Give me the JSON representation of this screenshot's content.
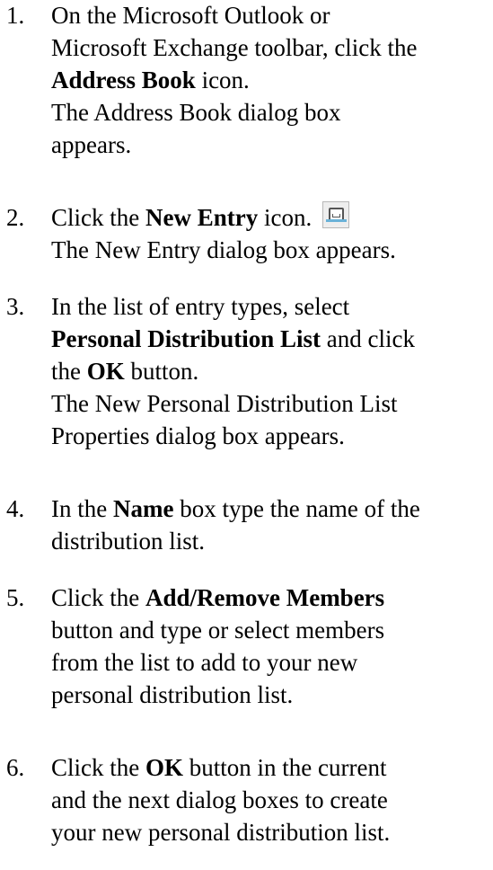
{
  "steps": [
    {
      "number": "1.",
      "lines": [
        [
          {
            "t": "On the Microsoft Outlook or"
          }
        ],
        [
          {
            "t": "Microsoft Exchange toolbar, click the"
          }
        ],
        [
          {
            "t": "Address Book",
            "b": true
          },
          {
            "t": " icon."
          }
        ],
        [
          {
            "t": "The Address Book dialog box"
          }
        ],
        [
          {
            "t": "appears."
          }
        ]
      ]
    },
    {
      "number": "2.",
      "lines": [
        [
          {
            "t": "Click the "
          },
          {
            "t": "New Entry",
            "b": true
          },
          {
            "t": " icon."
          },
          {
            "icon": "new-entry-icon"
          }
        ],
        [
          {
            "t": "The New Entry dialog box appears."
          }
        ]
      ]
    },
    {
      "number": "3.",
      "lines": [
        [
          {
            "t": "In the list of entry types, select"
          }
        ],
        [
          {
            "t": "Personal Distribution List",
            "b": true
          },
          {
            "t": " and click"
          }
        ],
        [
          {
            "t": "the "
          },
          {
            "t": "OK",
            "b": true
          },
          {
            "t": " button."
          }
        ],
        [
          {
            "t": "The New Personal Distribution List"
          }
        ],
        [
          {
            "t": "Properties dialog box appears."
          }
        ]
      ]
    },
    {
      "number": "4.",
      "lines": [
        [
          {
            "t": "In the "
          },
          {
            "t": "Name",
            "b": true
          },
          {
            "t": " box type the name of the"
          }
        ],
        [
          {
            "t": "distribution list."
          }
        ]
      ]
    },
    {
      "number": "5.",
      "lines": [
        [
          {
            "t": "Click the "
          },
          {
            "t": "Add/Remove Members",
            "b": true
          }
        ],
        [
          {
            "t": "button and type or select members"
          }
        ],
        [
          {
            "t": "from the list to add to your new"
          }
        ],
        [
          {
            "t": "personal distribution list."
          }
        ]
      ]
    },
    {
      "number": "6.",
      "lines": [
        [
          {
            "t": "Click the "
          },
          {
            "t": "OK",
            "b": true
          },
          {
            "t": " button in the current"
          }
        ],
        [
          {
            "t": "and the next dialog boxes to create"
          }
        ],
        [
          {
            "t": "your new personal distribution list."
          }
        ]
      ]
    }
  ]
}
